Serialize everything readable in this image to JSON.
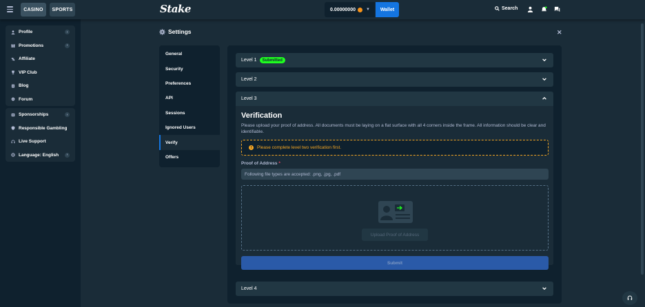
{
  "topbar": {
    "tabs": [
      "CASINO",
      "SPORTS"
    ],
    "logo": "Stake",
    "balance": "0.00000000",
    "wallet_label": "Wallet",
    "search_label": "Search"
  },
  "sidebar": {
    "group1": [
      {
        "label": "Profile",
        "icon": "user-icon",
        "arrow": true
      },
      {
        "label": "Promotions",
        "icon": "gift-icon",
        "arrow": true
      },
      {
        "label": "Affiliate",
        "icon": "affiliate-icon",
        "arrow": false
      },
      {
        "label": "VIP Club",
        "icon": "trophy-icon",
        "arrow": false
      },
      {
        "label": "Blog",
        "icon": "blog-icon",
        "arrow": false
      },
      {
        "label": "Forum",
        "icon": "forum-icon",
        "arrow": false
      }
    ],
    "group2": [
      {
        "label": "Sponsorships",
        "icon": "sponsor-icon",
        "arrow": true
      },
      {
        "label": "Responsible Gambling",
        "icon": "shield-icon",
        "arrow": false
      },
      {
        "label": "Live Support",
        "icon": "headset-icon",
        "arrow": false
      },
      {
        "label": "Language: English",
        "icon": "globe-icon",
        "arrow": true
      }
    ]
  },
  "settings": {
    "title": "Settings",
    "nav": [
      "General",
      "Security",
      "Preferences",
      "API",
      "Sessions",
      "Ignored Users",
      "Verify",
      "Offers"
    ],
    "active_nav": "Verify"
  },
  "levels": {
    "level1": {
      "label": "Level 1",
      "badge": "Submitted"
    },
    "level2": {
      "label": "Level 2"
    },
    "level3": {
      "label": "Level 3",
      "title": "Verification",
      "description": "Please upload your proof of address. All documents must be laying on a flat surface with all 4 corners inside the frame. All information should be clear and identifiable.",
      "warning": "Please complete level two verification first.",
      "proof_label": "Proof of Address",
      "required_mark": "*",
      "file_types": "Following file types are accepted: .png, .jpg, .pdf",
      "upload_label": "Upload Proof of Address",
      "submit_label": "Submit"
    },
    "level4": {
      "label": "Level 4"
    }
  },
  "colors": {
    "background": "#1a2c38",
    "sidebar": "#0f212e",
    "accent_blue": "#1475e1",
    "badge_green": "#1fff20",
    "warning_orange": "#f5a623"
  }
}
